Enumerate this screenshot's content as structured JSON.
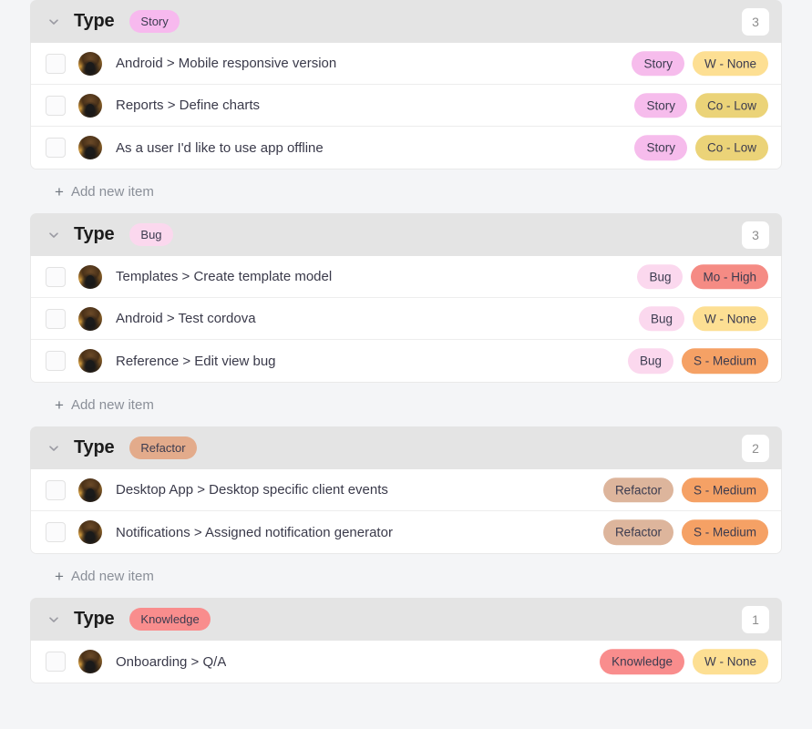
{
  "page": {
    "background": "#f4f5f7",
    "add_item_label": "Add new item",
    "add_item_icon": "plus-icon",
    "collapse_icon": "chevron-down-icon"
  },
  "palette": {
    "story_badge_bg": "#f7b9ee",
    "story_badge_bg_row": "#f6bcec",
    "bug_badge_bg": "#fbd8ee",
    "refactor_badge_bg_header": "#e3ab8b",
    "refactor_badge_bg_row": "#ddb59c",
    "knowledge_badge_bg": "#f98d8d",
    "priority_none_bg": "#fddf93",
    "priority_low_bg": "#ebd378",
    "priority_medium_bg": "#f5a165",
    "priority_high_bg": "#f58b84",
    "header_bg": "#e4e4e4",
    "row_bg": "#ffffff",
    "text": "#3a3a4a"
  },
  "groups": [
    {
      "title": "Type",
      "badge": {
        "label": "Story",
        "color": "#f7b9ee"
      },
      "count": "3",
      "items": [
        {
          "title": "Android > Mobile responsive version",
          "avatar": "user-avatar",
          "type_badge": {
            "label": "Story",
            "color": "#f6bcec"
          },
          "priority_badge": {
            "label": "W - None",
            "color": "#fddf93"
          }
        },
        {
          "title": "Reports > Define charts",
          "avatar": "user-avatar",
          "type_badge": {
            "label": "Story",
            "color": "#f6bcec"
          },
          "priority_badge": {
            "label": "Co - Low",
            "color": "#ebd378"
          }
        },
        {
          "title": "As a user I'd like to use app offline",
          "avatar": "user-avatar",
          "type_badge": {
            "label": "Story",
            "color": "#f6bcec"
          },
          "priority_badge": {
            "label": "Co - Low",
            "color": "#ebd378"
          }
        }
      ]
    },
    {
      "title": "Type",
      "badge": {
        "label": "Bug",
        "color": "#fbd8ee"
      },
      "count": "3",
      "items": [
        {
          "title": "Templates > Create template model",
          "avatar": "user-avatar",
          "type_badge": {
            "label": "Bug",
            "color": "#fbd8ee"
          },
          "priority_badge": {
            "label": "Mo - High",
            "color": "#f58b84"
          }
        },
        {
          "title": "Android > Test cordova",
          "avatar": "user-avatar",
          "type_badge": {
            "label": "Bug",
            "color": "#fbd8ee"
          },
          "priority_badge": {
            "label": "W - None",
            "color": "#fddf93"
          }
        },
        {
          "title": "Reference > Edit view bug",
          "avatar": "user-avatar",
          "type_badge": {
            "label": "Bug",
            "color": "#fbd8ee"
          },
          "priority_badge": {
            "label": "S - Medium",
            "color": "#f5a165"
          }
        }
      ]
    },
    {
      "title": "Type",
      "badge": {
        "label": "Refactor",
        "color": "#e3ab8b"
      },
      "count": "2",
      "items": [
        {
          "title": "Desktop App > Desktop specific client events",
          "avatar": "user-avatar",
          "type_badge": {
            "label": "Refactor",
            "color": "#ddb59c"
          },
          "priority_badge": {
            "label": "S - Medium",
            "color": "#f5a165"
          }
        },
        {
          "title": "Notifications > Assigned notification generator",
          "avatar": "user-avatar",
          "type_badge": {
            "label": "Refactor",
            "color": "#ddb59c"
          },
          "priority_badge": {
            "label": "S - Medium",
            "color": "#f5a165"
          }
        }
      ]
    },
    {
      "title": "Type",
      "badge": {
        "label": "Knowledge",
        "color": "#f98d8d"
      },
      "count": "1",
      "items": [
        {
          "title": "Onboarding > Q/A",
          "avatar": "user-avatar",
          "type_badge": {
            "label": "Knowledge",
            "color": "#f98d8d"
          },
          "priority_badge": {
            "label": "W - None",
            "color": "#fddf93"
          }
        }
      ]
    }
  ]
}
